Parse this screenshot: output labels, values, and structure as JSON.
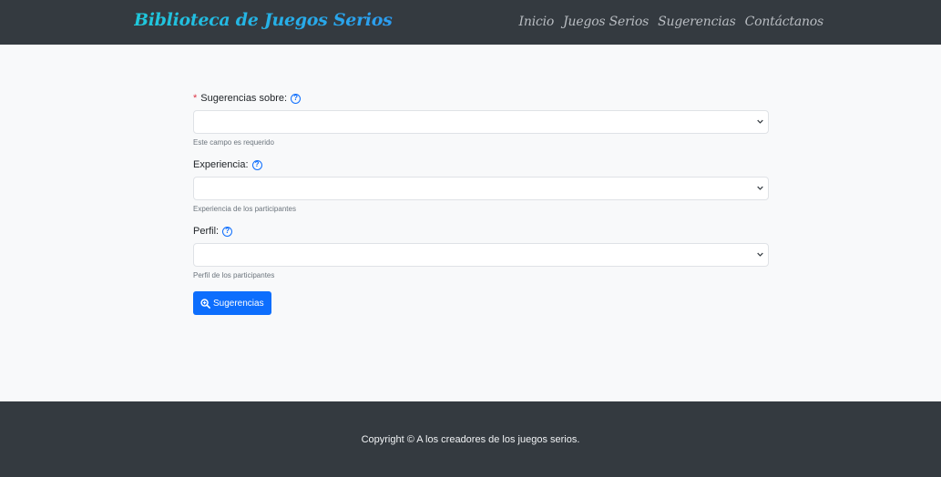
{
  "header": {
    "brand": "Biblioteca de Juegos Serios",
    "nav": [
      "Inicio",
      "Juegos Serios",
      "Sugerencias",
      "Contáctanos"
    ]
  },
  "form": {
    "fields": [
      {
        "label": "Sugerencias sobre:",
        "required": "*",
        "value": "",
        "hint": "Este campo es requerido"
      },
      {
        "label": "Experiencia:",
        "value": "",
        "hint": "Experiencia de los participantes"
      },
      {
        "label": "Perfil:",
        "value": "",
        "hint": "Perfil de los participantes"
      }
    ],
    "help_icon": "question-circle-icon",
    "submit_label": "Sugerencias",
    "submit_icon": "zoom-in-icon"
  },
  "footer": {
    "copyright": "Copyright © A los creadores de los juegos serios."
  },
  "colors": {
    "navbar": "#343a40",
    "primary": "#0d6efd",
    "required": "#dc3545",
    "background": "#f8f9fa"
  }
}
